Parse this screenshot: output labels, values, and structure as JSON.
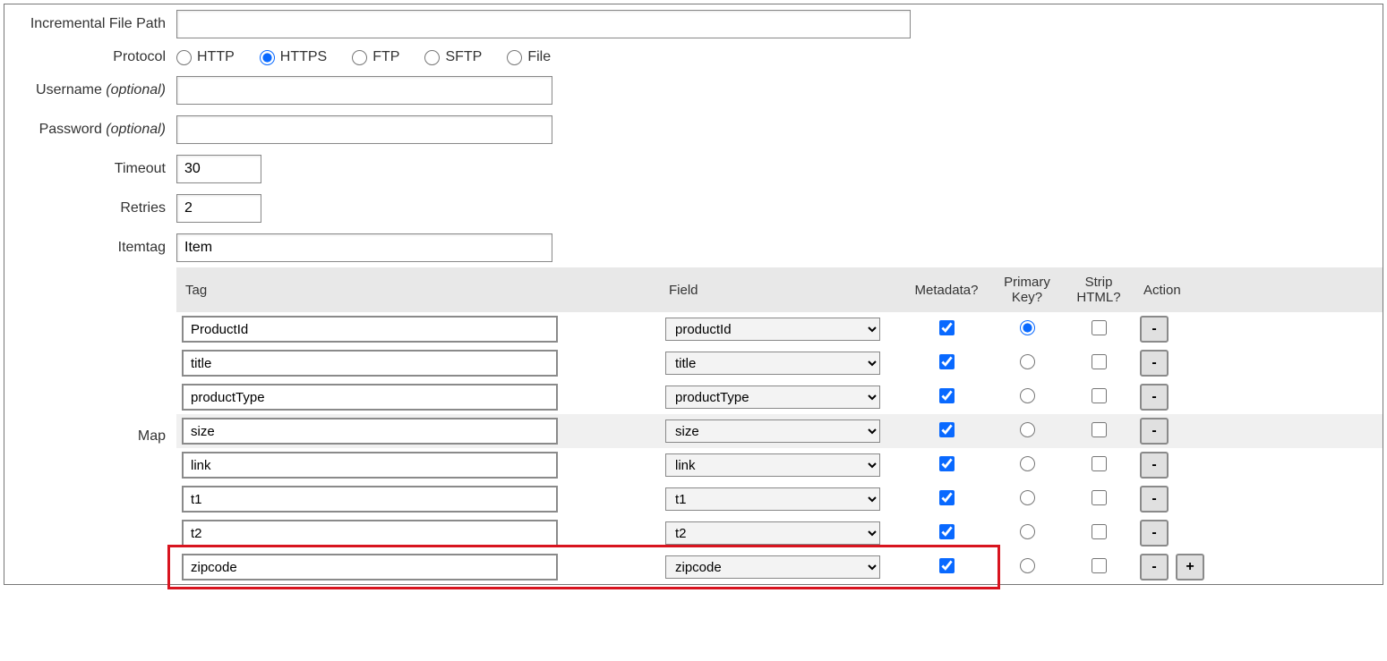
{
  "labels": {
    "incremental_file_path": "Incremental File Path",
    "protocol": "Protocol",
    "username": "Username",
    "password": "Password",
    "optional": "(optional)",
    "timeout": "Timeout",
    "retries": "Retries",
    "itemtag": "Itemtag",
    "map": "Map"
  },
  "values": {
    "incremental_file_path": "",
    "username": "",
    "password": "",
    "timeout": "30",
    "retries": "2",
    "itemtag": "Item"
  },
  "protocols": [
    {
      "label": "HTTP",
      "checked": false
    },
    {
      "label": "HTTPS",
      "checked": true
    },
    {
      "label": "FTP",
      "checked": false
    },
    {
      "label": "SFTP",
      "checked": false
    },
    {
      "label": "File",
      "checked": false
    }
  ],
  "map_headers": {
    "tag": "Tag",
    "field": "Field",
    "metadata": "Metadata?",
    "primary_key": "Primary\nKey?",
    "strip_html": "Strip\nHTML?",
    "action": "Action"
  },
  "map_rows": [
    {
      "tag": "ProductId",
      "field": "productId",
      "metadata": true,
      "primary_key": true,
      "strip_html": false,
      "hl": false
    },
    {
      "tag": "title",
      "field": "title",
      "metadata": true,
      "primary_key": false,
      "strip_html": false,
      "hl": false
    },
    {
      "tag": "productType",
      "field": "productType",
      "metadata": true,
      "primary_key": false,
      "strip_html": false,
      "hl": false
    },
    {
      "tag": "size",
      "field": "size",
      "metadata": true,
      "primary_key": false,
      "strip_html": false,
      "hl": true
    },
    {
      "tag": "link",
      "field": "link",
      "metadata": true,
      "primary_key": false,
      "strip_html": false,
      "hl": false
    },
    {
      "tag": "t1",
      "field": "t1",
      "metadata": true,
      "primary_key": false,
      "strip_html": false,
      "hl": false
    },
    {
      "tag": "t2",
      "field": "t2",
      "metadata": true,
      "primary_key": false,
      "strip_html": false,
      "hl": false
    },
    {
      "tag": "zipcode",
      "field": "zipcode",
      "metadata": true,
      "primary_key": false,
      "strip_html": false,
      "hl": false
    }
  ],
  "buttons": {
    "remove": "-",
    "add": "+"
  }
}
